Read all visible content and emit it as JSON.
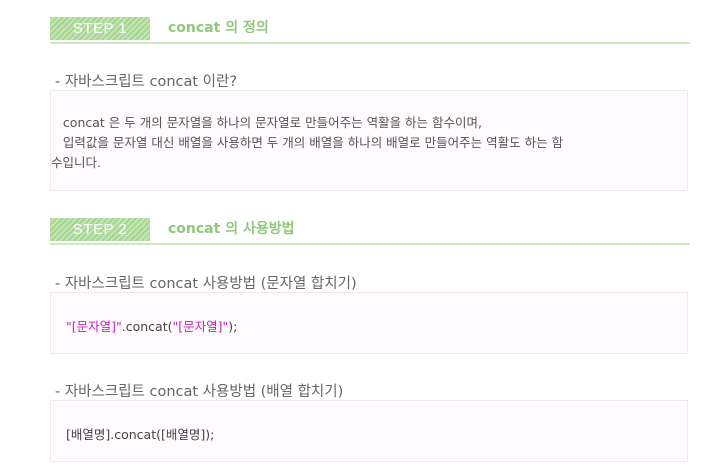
{
  "step1": {
    "badge": "STEP 1",
    "title": "concat 의 정의"
  },
  "section1": {
    "heading": "- 자바스크립트 concat 이란?",
    "line1": "   concat 은 두 개의 문자열을 하나의 문자열로 만들어주는 역활을 하는 함수이며,",
    "line2": "   입력값을 문자열 대신 배열을 사용하면 두 개의 배열을 하나의 배열로 만들어주는 역활도 하는 함",
    "line3": "수입니다."
  },
  "step2": {
    "badge": "STEP 2",
    "title": "concat 의 사용방법"
  },
  "section2": {
    "heading": "- 자바스크립트 concat 사용방법 (문자열 합치기)",
    "code_str1": "\"[문자열]\"",
    "code_mid": ".concat(",
    "code_str2": "\"[문자열]\"",
    "code_end": ");"
  },
  "section3": {
    "heading": "- 자바스크립트 concat 사용방법 (배열 합치기)",
    "code": "[배열명].concat([배열명]);"
  },
  "colors": {
    "accent_green": "#90c97c",
    "string_magenta": "#c026c0",
    "box_bg": "#fffafd"
  }
}
